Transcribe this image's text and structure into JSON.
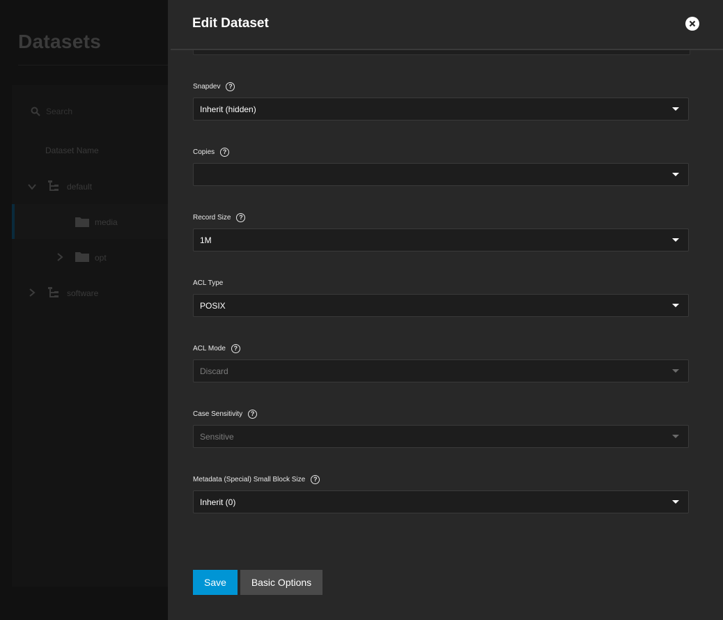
{
  "background": {
    "title": "Datasets",
    "search_placeholder": "Search",
    "column_header": "Dataset Name",
    "tree": [
      {
        "label": "default"
      },
      {
        "label": "media"
      },
      {
        "label": "opt"
      },
      {
        "label": "software"
      }
    ]
  },
  "panel": {
    "title": "Edit Dataset",
    "fields": {
      "snapdev": {
        "label": "Snapdev",
        "value": "Inherit (hidden)"
      },
      "copies": {
        "label": "Copies",
        "value": ""
      },
      "record_size": {
        "label": "Record Size",
        "value": "1M"
      },
      "acl_type": {
        "label": "ACL Type",
        "value": "POSIX"
      },
      "acl_mode": {
        "label": "ACL Mode",
        "value": "Discard"
      },
      "case_sensitivity": {
        "label": "Case Sensitivity",
        "value": "Sensitive"
      },
      "special_small_block": {
        "label": "Metadata (Special) Small Block Size",
        "value": "Inherit (0)"
      }
    },
    "buttons": {
      "save": "Save",
      "basic_options": "Basic Options"
    }
  },
  "colors": {
    "accent": "#0095d5",
    "panel_bg": "#282828",
    "input_bg": "#1d1d1d"
  }
}
